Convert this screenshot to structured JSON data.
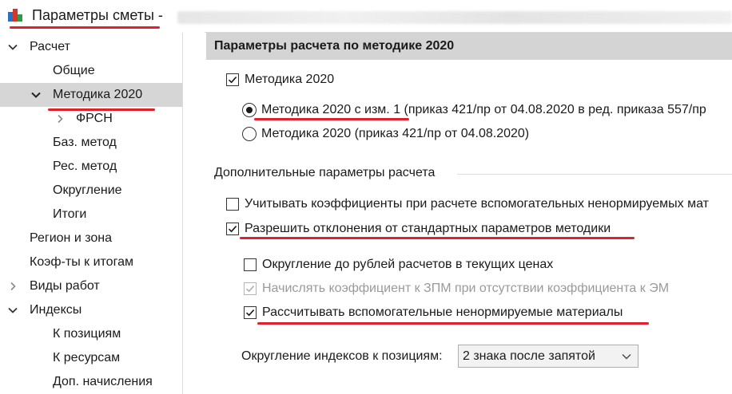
{
  "window": {
    "title": "Параметры сметы -"
  },
  "sidebar": {
    "items": [
      {
        "label": "Расчет",
        "expander": "chevron-down"
      },
      {
        "label": "Общие"
      },
      {
        "label": "Методика 2020",
        "expander": "chevron-down",
        "selected": true
      },
      {
        "label": "ФРСН",
        "expander": "chevron-right"
      },
      {
        "label": "Баз. метод"
      },
      {
        "label": "Рес. метод"
      },
      {
        "label": "Округление"
      },
      {
        "label": "Итоги"
      },
      {
        "label": "Регион и зона"
      },
      {
        "label": "Коэф-ты к итогам"
      },
      {
        "label": "Виды работ",
        "expander": "chevron-right"
      },
      {
        "label": "Индексы",
        "expander": "chevron-down"
      },
      {
        "label": "К позициям"
      },
      {
        "label": "К ресурсам"
      },
      {
        "label": "Доп. начисления"
      }
    ]
  },
  "main": {
    "header": "Параметры расчета по методике 2020",
    "methodology_checkbox": {
      "label": "Методика 2020",
      "checked": true
    },
    "radio_options": [
      {
        "label": "Методика 2020 с изм. 1",
        "suffix": " (приказ 421/пр от 04.08.2020 в ред. приказа 557/пр",
        "selected": true
      },
      {
        "label": "Методика 2020 (приказ 421/пр от 04.08.2020)",
        "suffix": "",
        "selected": false
      }
    ],
    "additional_group_title": "Дополнительные параметры расчета",
    "options": [
      {
        "label": "Учитывать коэффициенты при расчете вспомогательных ненормируемых мат",
        "checked": false,
        "disabled": false
      },
      {
        "label": "Разрешить отклонения от стандартных параметров методики",
        "checked": true,
        "disabled": false
      }
    ],
    "sub_options": [
      {
        "label": "Округление до рублей расчетов в текущих ценах",
        "checked": false,
        "disabled": false
      },
      {
        "label": "Начислять коэффициент к ЗПМ при отсутствии коэффициента к ЭМ",
        "checked": true,
        "disabled": true
      },
      {
        "label": "Рассчитывать вспомогательные ненормируемые материалы",
        "checked": true,
        "disabled": false
      }
    ],
    "rounding": {
      "label": "Округление индексов к позициям:",
      "selected": "2 знака после запятой"
    }
  },
  "colors": {
    "highlight_red": "#e0202a",
    "header_bg": "#d4d4d4",
    "selection_bg": "#d6d6d6"
  }
}
